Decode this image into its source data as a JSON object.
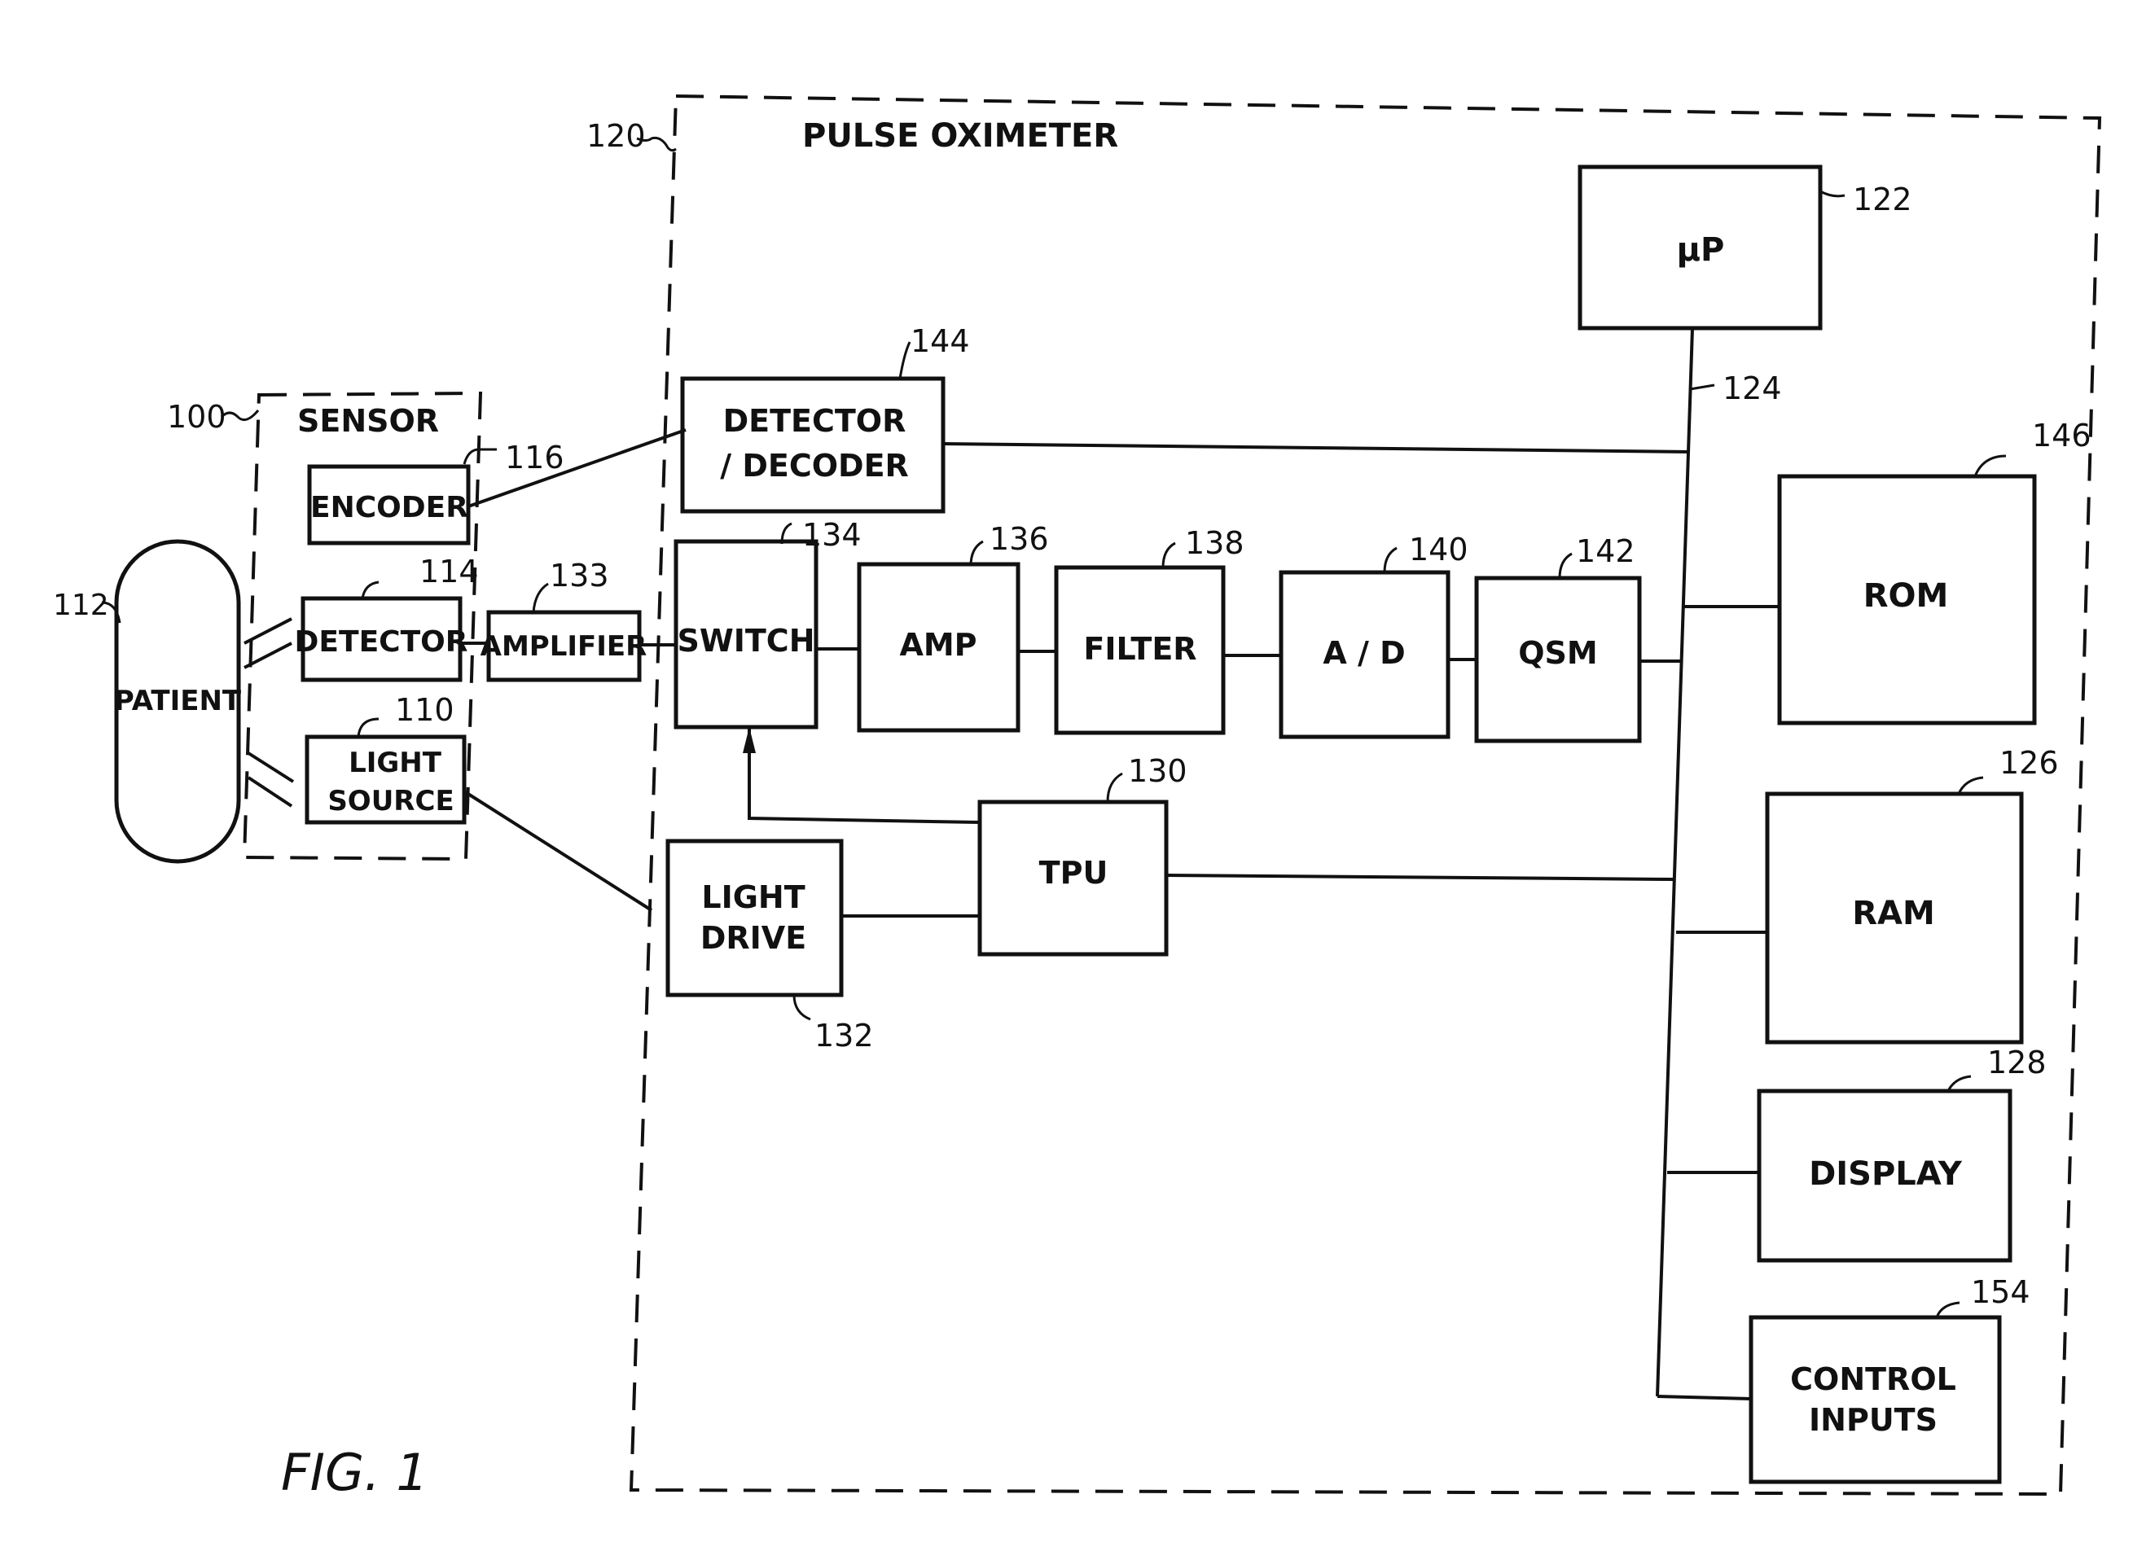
{
  "figure_label": "FIG. 1",
  "groups": {
    "pulse_oximeter": {
      "title": "PULSE OXIMETER",
      "ref": "120"
    },
    "sensor": {
      "title": "SENSOR",
      "ref": "100"
    }
  },
  "blocks": {
    "patient": {
      "lines": [
        "PATIENT"
      ],
      "ref": "112"
    },
    "encoder": {
      "lines": [
        "ENCODER"
      ],
      "ref": "116"
    },
    "detector": {
      "lines": [
        "DETECTOR"
      ],
      "ref": "114"
    },
    "light_source": {
      "lines": [
        "LIGHT",
        "SOURCE"
      ],
      "ref": "110"
    },
    "amplifier": {
      "lines": [
        "AMPLIFIER"
      ],
      "ref": "133"
    },
    "detector_decoder": {
      "lines": [
        "DETECTOR",
        "/ DECODER"
      ],
      "ref": "144"
    },
    "microprocessor": {
      "lines": [
        "µP"
      ],
      "ref": "122"
    },
    "switch": {
      "lines": [
        "SWITCH"
      ],
      "ref": "134"
    },
    "amp": {
      "lines": [
        "AMP"
      ],
      "ref": "136"
    },
    "filter": {
      "lines": [
        "FILTER"
      ],
      "ref": "138"
    },
    "a_d": {
      "lines": [
        "A / D"
      ],
      "ref": "140"
    },
    "qsm": {
      "lines": [
        "QSM"
      ],
      "ref": "142"
    },
    "tpu": {
      "lines": [
        "TPU"
      ],
      "ref": "130"
    },
    "light_drive": {
      "lines": [
        "LIGHT",
        "DRIVE"
      ],
      "ref": "132"
    },
    "rom": {
      "lines": [
        "ROM"
      ],
      "ref": "146"
    },
    "ram": {
      "lines": [
        "RAM"
      ],
      "ref": "126"
    },
    "display": {
      "lines": [
        "DISPLAY"
      ],
      "ref": "128"
    },
    "control_inputs": {
      "lines": [
        "CONTROL",
        "INPUTS"
      ],
      "ref": "154"
    }
  },
  "bus": {
    "ref": "124"
  }
}
